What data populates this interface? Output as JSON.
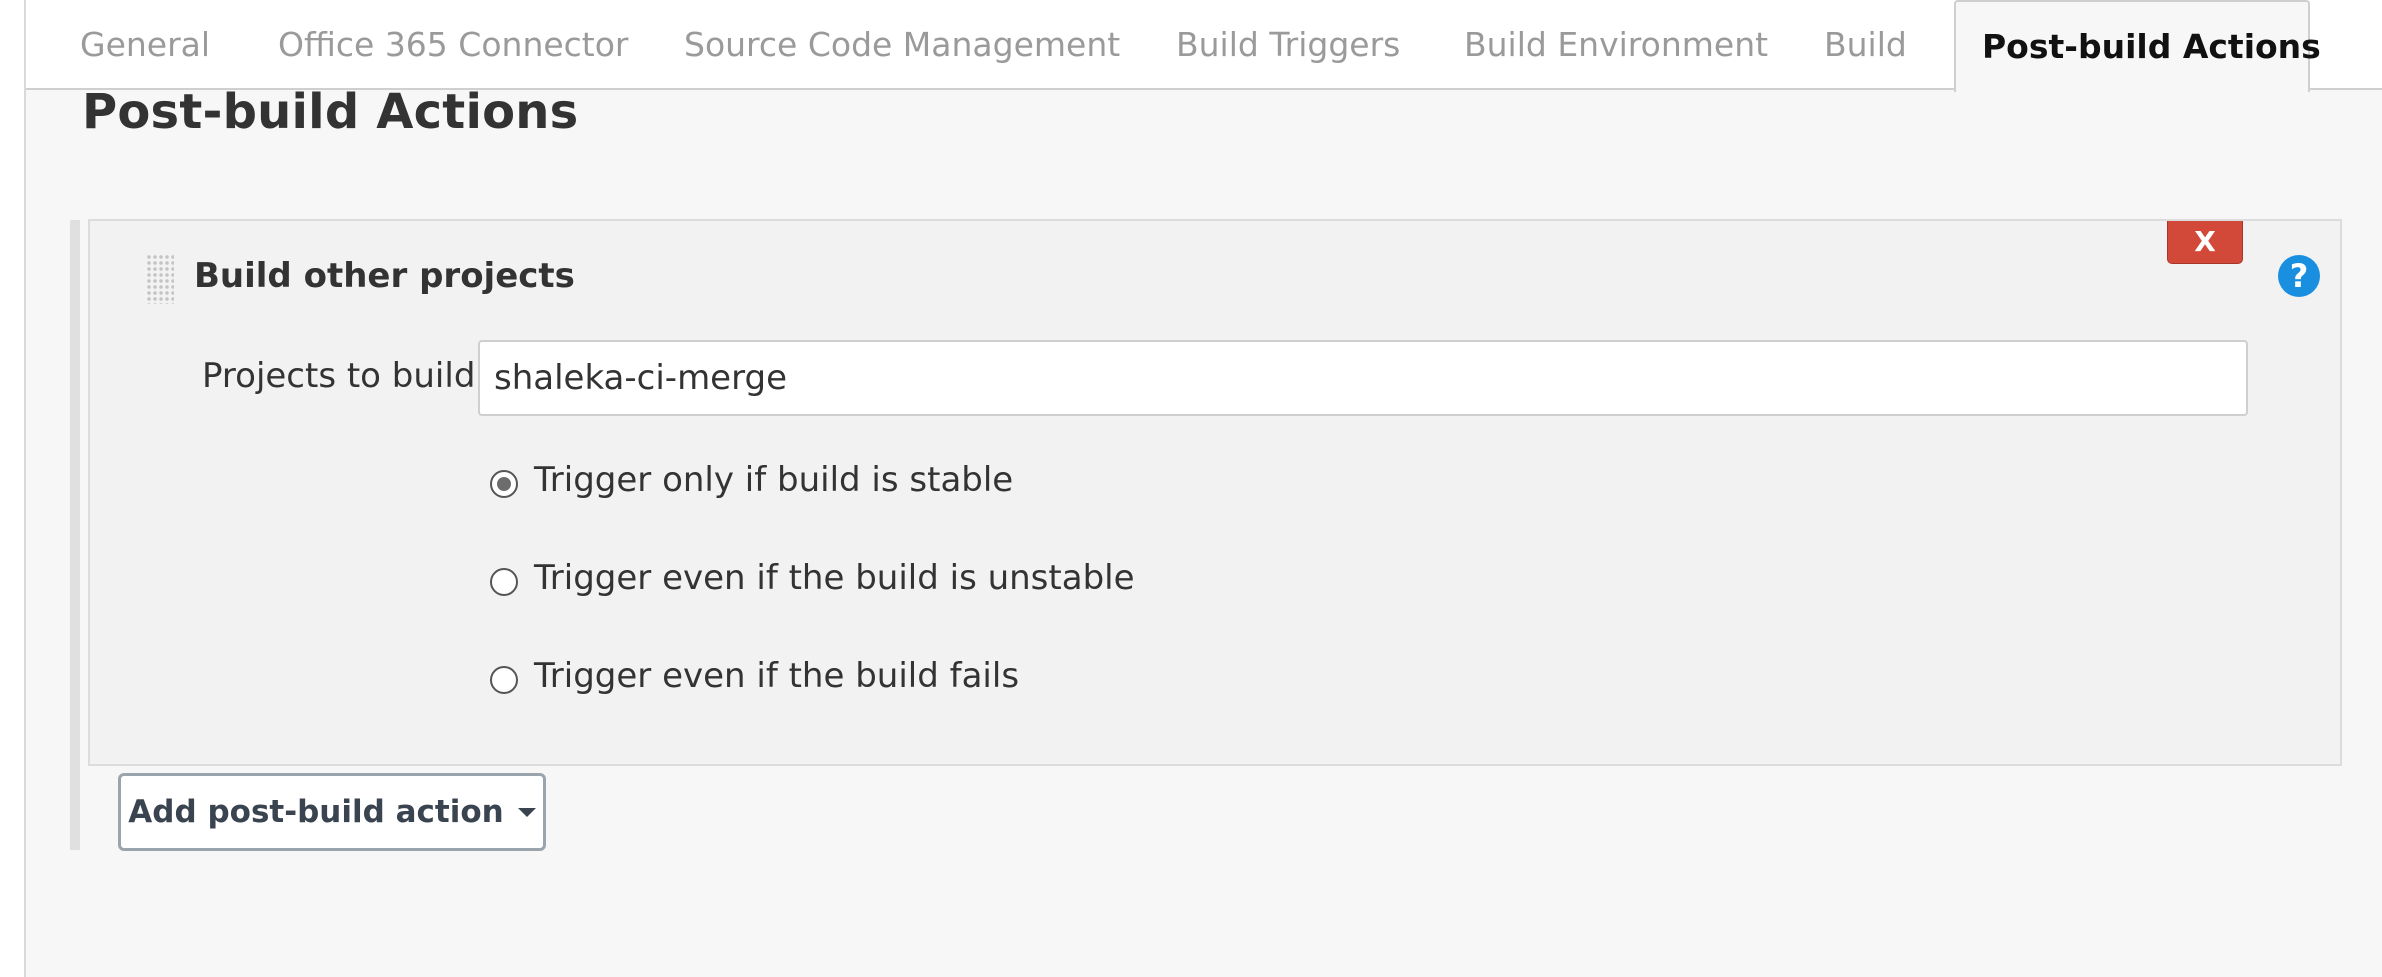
{
  "tabs": [
    {
      "label": "General",
      "active": false
    },
    {
      "label": "Office 365 Connector",
      "active": false
    },
    {
      "label": "Source Code Management",
      "active": false
    },
    {
      "label": "Build Triggers",
      "active": false
    },
    {
      "label": "Build Environment",
      "active": false
    },
    {
      "label": "Build",
      "active": false
    },
    {
      "label": "Post-build Actions",
      "active": true
    }
  ],
  "section": {
    "title": "Post-build Actions"
  },
  "action": {
    "title": "Build other projects",
    "delete_label": "X",
    "help_label": "?",
    "projects_label": "Projects to build",
    "projects_value": "shaleka-ci-merge",
    "trigger_options": [
      {
        "label": "Trigger only if build is stable",
        "selected": true
      },
      {
        "label": "Trigger even if the build is unstable",
        "selected": false
      },
      {
        "label": "Trigger even if the build fails",
        "selected": false
      }
    ]
  },
  "add_button": {
    "label": "Add post-build action",
    "icon": "chevron-down-icon"
  },
  "colors": {
    "delete": "#d24939",
    "help": "#1a8fe0",
    "tab_inactive": "#9a9a9a",
    "tab_active": "#111111"
  }
}
